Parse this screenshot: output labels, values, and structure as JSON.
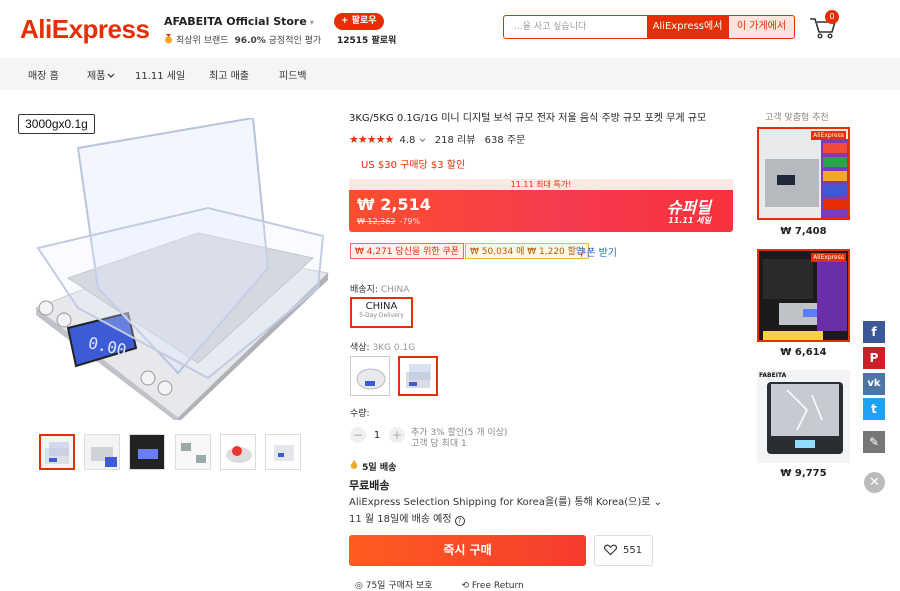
{
  "header": {
    "logo": "AliExpress",
    "store_name": "AFABEITA Official Store",
    "store_caret": "▾",
    "store_badge": "최상위 브랜드",
    "store_rating": "96.0%",
    "store_rating_label": "긍정적인 평가",
    "follow_label": "+ 팔로우",
    "followers": "12515 팔로워",
    "search_placeholder": "...을 사고 싶습니다",
    "search_ali": "AliExpress에서",
    "search_store": "이 가게에서",
    "cart_count": "0"
  },
  "nav": {
    "items": [
      "매장 홈",
      "제품",
      "11.11 세일",
      "최고 매출",
      "피드백"
    ]
  },
  "gallery": {
    "spec_badge": "3000gx0.1g"
  },
  "product": {
    "title": "3KG/5KG 0.1G/1G 미니 디지털 보석 규모 전자 저울 음식 주방 규모 포켓 무게 규모",
    "rating_value": 4.8,
    "rating": "4.8",
    "reviews": "218 리뷰",
    "orders": "638 주문",
    "store_coupon": "US $30 구매당 $3 할인"
  },
  "price": {
    "banner_top": "11.11 최대 특가!",
    "current": "₩ 2,514",
    "original": "₩ 12,362",
    "discount": "-79%",
    "superdeal": "슈퍼딜",
    "superdeal_sub": "11.11 세일"
  },
  "coupons": {
    "c1": "₩ 4,271 당신을 위한 쿠폰",
    "c2": "₩ 50,034 에 ₩ 1,220 할인",
    "link": "쿠폰 받기"
  },
  "shipping_from": {
    "label": "배송지:",
    "value": "CHINA",
    "option": "CHINA",
    "option_sub": "5-Day Delivery"
  },
  "color": {
    "label": "색상:",
    "value": "3KG 0.1G"
  },
  "quantity": {
    "label": "수량:",
    "minus": "−",
    "value": "1",
    "plus": "+",
    "note1": "추가 3% 할인(5 개 이상)",
    "note2": "고객 당 최대 1"
  },
  "delivery": {
    "tag": "5일 배송",
    "free": "무료배송",
    "desc": "AliExpress Selection Shipping for Korea을(를) 통해 Korea(으)로",
    "desc_caret": "⌄",
    "date_prefix": "11 월 18일",
    "date_suffix": "에 배송 예정",
    "help": "?"
  },
  "actions": {
    "buy": "즉시 구매",
    "wishlist_count": "551"
  },
  "bottom": {
    "guarantee": "75일 구매자 보호",
    "free_return": "Free Return"
  },
  "recommend": {
    "title": "고객 맞춤형 추천",
    "prices": [
      "₩ 7,408",
      "₩ 6,614",
      "₩ 9,775"
    ],
    "badge": "AliExpress",
    "brand": "FABEITA"
  },
  "share": {
    "f": "f",
    "p": "P",
    "vk": "vk",
    "tw": "t",
    "edit": "✎",
    "close": "✕"
  },
  "colors": {
    "brand": "#e62e04",
    "link": "#2066c8"
  }
}
